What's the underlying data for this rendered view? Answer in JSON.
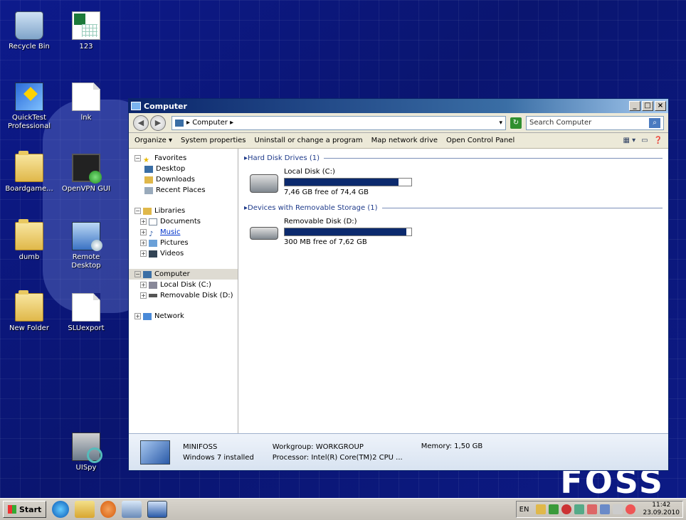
{
  "desktop": {
    "icons": [
      {
        "label": "Recycle Bin"
      },
      {
        "label": "123"
      },
      {
        "label": "QuickTest Professional"
      },
      {
        "label": "lnk"
      },
      {
        "label": "Boardgame..."
      },
      {
        "label": "OpenVPN GUI"
      },
      {
        "label": "dumb"
      },
      {
        "label": "Remote Desktop"
      },
      {
        "label": "New Folder"
      },
      {
        "label": "SLUexport"
      },
      {
        "label": "UISpy"
      }
    ],
    "watermark": "FOSS"
  },
  "window": {
    "title": "Computer",
    "buttons": {
      "minimize": "_",
      "maximize": "□",
      "close": "×"
    },
    "address": {
      "breadcrumb": "▸ Computer ▸",
      "dropdown": "▾"
    },
    "search": {
      "placeholder": "Search Computer"
    },
    "toolbar": {
      "organize": "Organize ▾",
      "system_properties": "System properties",
      "uninstall": "Uninstall or change a program",
      "map_drive": "Map network drive",
      "control_panel": "Open Control Panel"
    },
    "nav": {
      "favorites": "Favorites",
      "desktop": "Desktop",
      "downloads": "Downloads",
      "recent": "Recent Places",
      "libraries": "Libraries",
      "documents": "Documents",
      "music": "Music",
      "pictures": "Pictures",
      "videos": "Videos",
      "computer": "Computer",
      "local_disk": "Local Disk (C:)",
      "removable": "Removable Disk (D:)",
      "network": "Network"
    },
    "groups": {
      "hdd": "Hard Disk Drives (1)",
      "removable": "Devices with Removable Storage (1)"
    },
    "drives": [
      {
        "name": "Local Disk (C:)",
        "free": "7,46 GB free of 74,4 GB",
        "used_fraction": 0.9
      },
      {
        "name": "Removable Disk (D:)",
        "free": "300 MB free of 7,62 GB",
        "used_fraction": 0.96
      }
    ],
    "details": {
      "name": "MINIFOSS",
      "os": "Windows 7 installed",
      "workgroup": "Workgroup: WORKGROUP",
      "processor": "Processor: Intel(R) Core(TM)2 CPU ...",
      "memory": "Memory: 1,50 GB"
    }
  },
  "taskbar": {
    "start": "Start",
    "lang": "EN",
    "time": "11:42",
    "date": "23.09.2010"
  }
}
